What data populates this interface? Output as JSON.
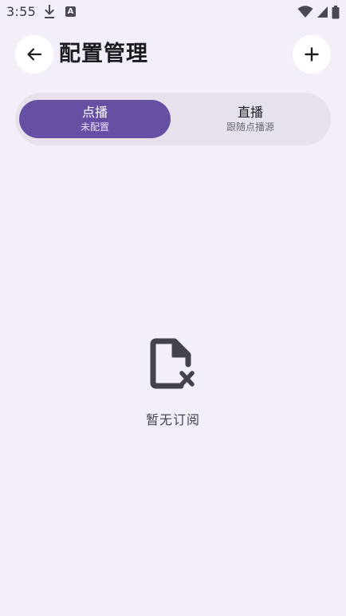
{
  "status_bar": {
    "time": "3:55",
    "notification_letter": "A",
    "icons": [
      "download-icon",
      "a-app-icon",
      "wifi-icon",
      "signal-icon",
      "battery-icon"
    ]
  },
  "header": {
    "title": "配置管理",
    "back_icon": "arrow-left-icon",
    "add_icon": "plus-icon"
  },
  "tabs": [
    {
      "label": "点播",
      "sublabel": "未配置",
      "active": true
    },
    {
      "label": "直播",
      "sublabel": "跟随点播源",
      "active": false
    }
  ],
  "empty_state": {
    "icon": "file-x-icon",
    "message": "暂无订阅"
  },
  "colors": {
    "background": "#f3eef8",
    "accent": "#6750a4",
    "segment_track": "#e6e1ea",
    "icon_dark": "#45434a"
  }
}
